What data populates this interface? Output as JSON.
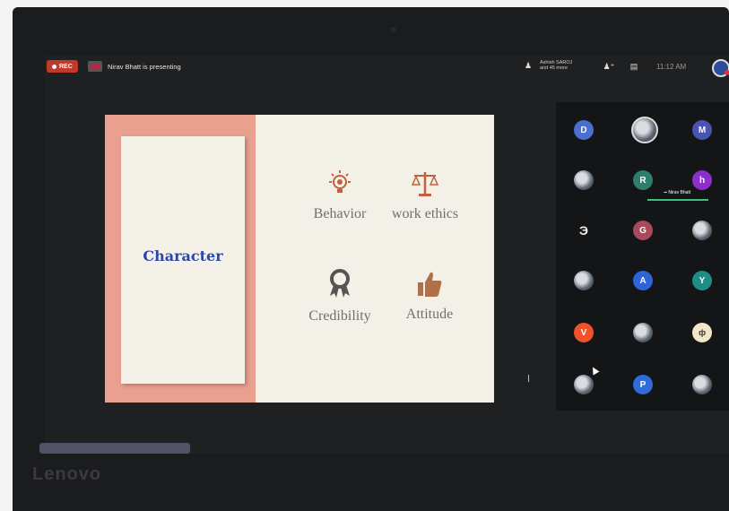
{
  "topbar": {
    "rec_label": "REC",
    "presenting_text": "Nirav Bhatt is presenting",
    "participants_text": "Ashish SAROJ and 45 more",
    "time": "11:12 AM",
    "icons": [
      "record-dot",
      "presentation-icon",
      "people-icon",
      "people-plus-icon",
      "chat-icon",
      "user-avatar"
    ]
  },
  "slide": {
    "left_title": "Character",
    "items": [
      {
        "label": "Behavior",
        "icon": "lightbulb-icon"
      },
      {
        "label": "work ethics",
        "icon": "scales-icon"
      },
      {
        "label": "Credibility",
        "icon": "award-ribbon-icon"
      },
      {
        "label": "Attitude",
        "icon": "thumbs-up-icon"
      }
    ],
    "colors": {
      "accent": "#e9a08e",
      "text": "#6f6f6f",
      "title": "#2f46a8",
      "icon": "#c1613e"
    }
  },
  "participants": {
    "speaker_label": "Nirav Bhatt",
    "tiles": [
      {
        "letter": "D",
        "color": "#4a6fcf"
      },
      {
        "letter": "",
        "color": "#777",
        "photo": true
      },
      {
        "letter": "M",
        "color": "#4a55b3"
      },
      {
        "letter": "",
        "color": "#777",
        "photo": true
      },
      {
        "letter": "R",
        "color": "#2f7d6d"
      },
      {
        "letter": "h",
        "color": "#8d2fc9"
      },
      {
        "letter": "",
        "color": "#ddd",
        "photo": true
      },
      {
        "letter": "G",
        "color": "#a8495c"
      },
      {
        "letter": "",
        "color": "#777",
        "photo": true
      },
      {
        "letter": "",
        "color": "#777",
        "photo": true
      },
      {
        "letter": "A",
        "color": "#2f64d8"
      },
      {
        "letter": "Y",
        "color": "#1f8c86"
      },
      {
        "letter": "V",
        "color": "#f0502c"
      },
      {
        "letter": "",
        "color": "#777",
        "photo": true
      },
      {
        "letter": "",
        "color": "#777",
        "photo": true
      },
      {
        "letter": "",
        "color": "#777",
        "photo": true
      },
      {
        "letter": "P",
        "color": "#2f6cd9"
      },
      {
        "letter": "",
        "color": "#777",
        "photo": true
      }
    ]
  },
  "device": {
    "brand": "Lenovo"
  }
}
